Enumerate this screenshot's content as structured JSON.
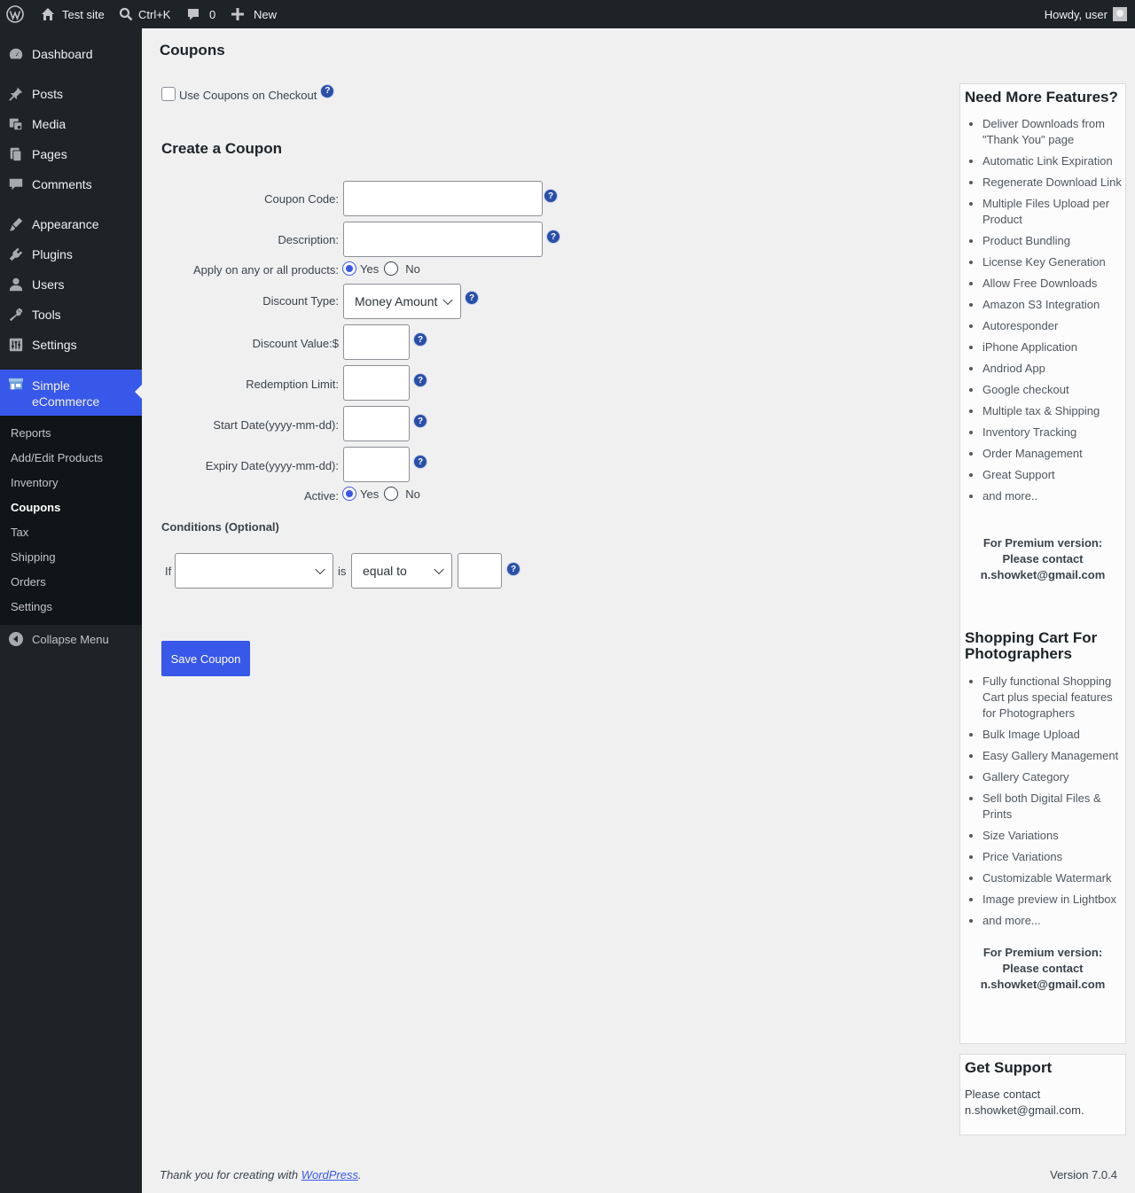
{
  "adminbar": {
    "site_name": "Test site",
    "search_shortcut": "Ctrl+K",
    "comments_count": "0",
    "new_label": "New",
    "greeting": "Howdy, user"
  },
  "sidebar": {
    "items": [
      {
        "label": "Dashboard",
        "icon": "dashboard-icon"
      },
      {
        "label": "Posts",
        "icon": "pin-icon"
      },
      {
        "label": "Media",
        "icon": "media-icon"
      },
      {
        "label": "Pages",
        "icon": "pages-icon"
      },
      {
        "label": "Comments",
        "icon": "comment-icon"
      },
      {
        "label": "Appearance",
        "icon": "brush-icon"
      },
      {
        "label": "Plugins",
        "icon": "plug-icon"
      },
      {
        "label": "Users",
        "icon": "user-icon"
      },
      {
        "label": "Tools",
        "icon": "wrench-icon"
      },
      {
        "label": "Settings",
        "icon": "sliders-icon"
      },
      {
        "label": "Simple eCommerce",
        "icon": "store-icon"
      }
    ],
    "submenu": [
      "Reports",
      "Add/Edit Products",
      "Inventory",
      "Coupons",
      "Tax",
      "Shipping",
      "Orders",
      "Settings"
    ],
    "collapse_label": "Collapse Menu"
  },
  "main": {
    "page_title": "Coupons",
    "use_coupons_label": "Use Coupons on Checkout",
    "section_title": "Create a Coupon",
    "fields": {
      "coupon_code": "Coupon Code:",
      "description": "Description:",
      "apply_products": "Apply on any or all products:",
      "discount_type": "Discount Type:",
      "discount_value": "Discount Value:$",
      "redemption_limit": "Redemption Limit:",
      "start_date": "Start Date(yyyy-mm-dd):",
      "expiry_date": "Expiry Date(yyyy-mm-dd):",
      "active": "Active:"
    },
    "yes_label": "Yes",
    "no_label": "No",
    "discount_type_value": "Money Amount",
    "conditions_title": "Conditions (Optional)",
    "if_label": "If",
    "is_label": "is",
    "condition_operator": "equal to",
    "save_button": "Save Coupon",
    "help_glyph": "?"
  },
  "panels": {
    "features_title": "Need More Features?",
    "features": [
      "Deliver Downloads from \"Thank You\" page",
      "Automatic Link Expiration",
      "Regenerate Download Link",
      "Multiple Files Upload per Product",
      "Product Bundling",
      "License Key Generation",
      "Allow Free Downloads",
      "Amazon S3 Integration",
      "Autoresponder",
      "iPhone Application",
      "Andriod App",
      "Google checkout",
      "Multiple tax & Shipping",
      "Inventory Tracking",
      "Order Management",
      "Great Support",
      "and more.."
    ],
    "premium_line1": "For Premium version:",
    "premium_line2": "Please contact",
    "premium_email": "n.showket@gmail.com",
    "photo_title": "Shopping Cart For Photographers",
    "photo_features": [
      "Fully functional Shopping Cart plus special features for Photographers",
      "Bulk Image Upload",
      "Easy Gallery Management",
      "Gallery Category",
      "Sell both Digital Files & Prints",
      "Size Variations",
      "Price Variations",
      "Customizable Watermark",
      "Image preview in Lightbox",
      "and more..."
    ],
    "support_title": "Get Support",
    "support_text": "Please contact n.showket@gmail.com."
  },
  "footer": {
    "thanks_prefix": "Thank you for creating with ",
    "wp_link": "WordPress",
    "thanks_suffix": ".",
    "version": "Version 7.0.4"
  }
}
